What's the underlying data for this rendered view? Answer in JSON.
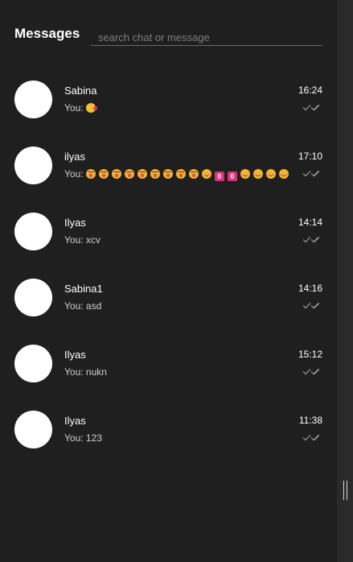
{
  "header": {
    "title": "Messages",
    "search_placeholder": "search chat or message"
  },
  "chats": [
    {
      "name": "Sabina",
      "time": "16:24",
      "preview_prefix": "You: ",
      "preview_text": "",
      "emoji": [
        "kiss"
      ],
      "status_icon": "double-check-icon"
    },
    {
      "name": "ilyas",
      "time": "17:10",
      "preview_prefix": "You: ",
      "preview_text": "",
      "emoji": [
        "tongue",
        "tongue",
        "tongue",
        "tongue",
        "tongue",
        "tongue",
        "tongue",
        "tongue",
        "tongue",
        "smile-kiss",
        "keycap-0",
        "keycap-0",
        "blush",
        "blush",
        "blush",
        "blush"
      ],
      "status_icon": "double-check-icon"
    },
    {
      "name": "Ilyas",
      "time": "14:14",
      "preview_prefix": "You: ",
      "preview_text": "xcv",
      "emoji": [],
      "status_icon": "double-check-icon"
    },
    {
      "name": "Sabina1",
      "time": "14:16",
      "preview_prefix": "You: ",
      "preview_text": "asd",
      "emoji": [],
      "status_icon": "double-check-icon"
    },
    {
      "name": "Ilyas",
      "time": "15:12",
      "preview_prefix": "You: ",
      "preview_text": "nukn",
      "emoji": [],
      "status_icon": "double-check-icon"
    },
    {
      "name": "Ilyas",
      "time": "11:38",
      "preview_prefix": "You: ",
      "preview_text": "123",
      "emoji": [],
      "status_icon": "double-check-icon"
    }
  ],
  "keycap_label": "0",
  "colors": {
    "background": "#1f1f1f",
    "sidebar": "#2a2a2a",
    "avatar": "#ffffff",
    "check": "#9a9a9a"
  }
}
